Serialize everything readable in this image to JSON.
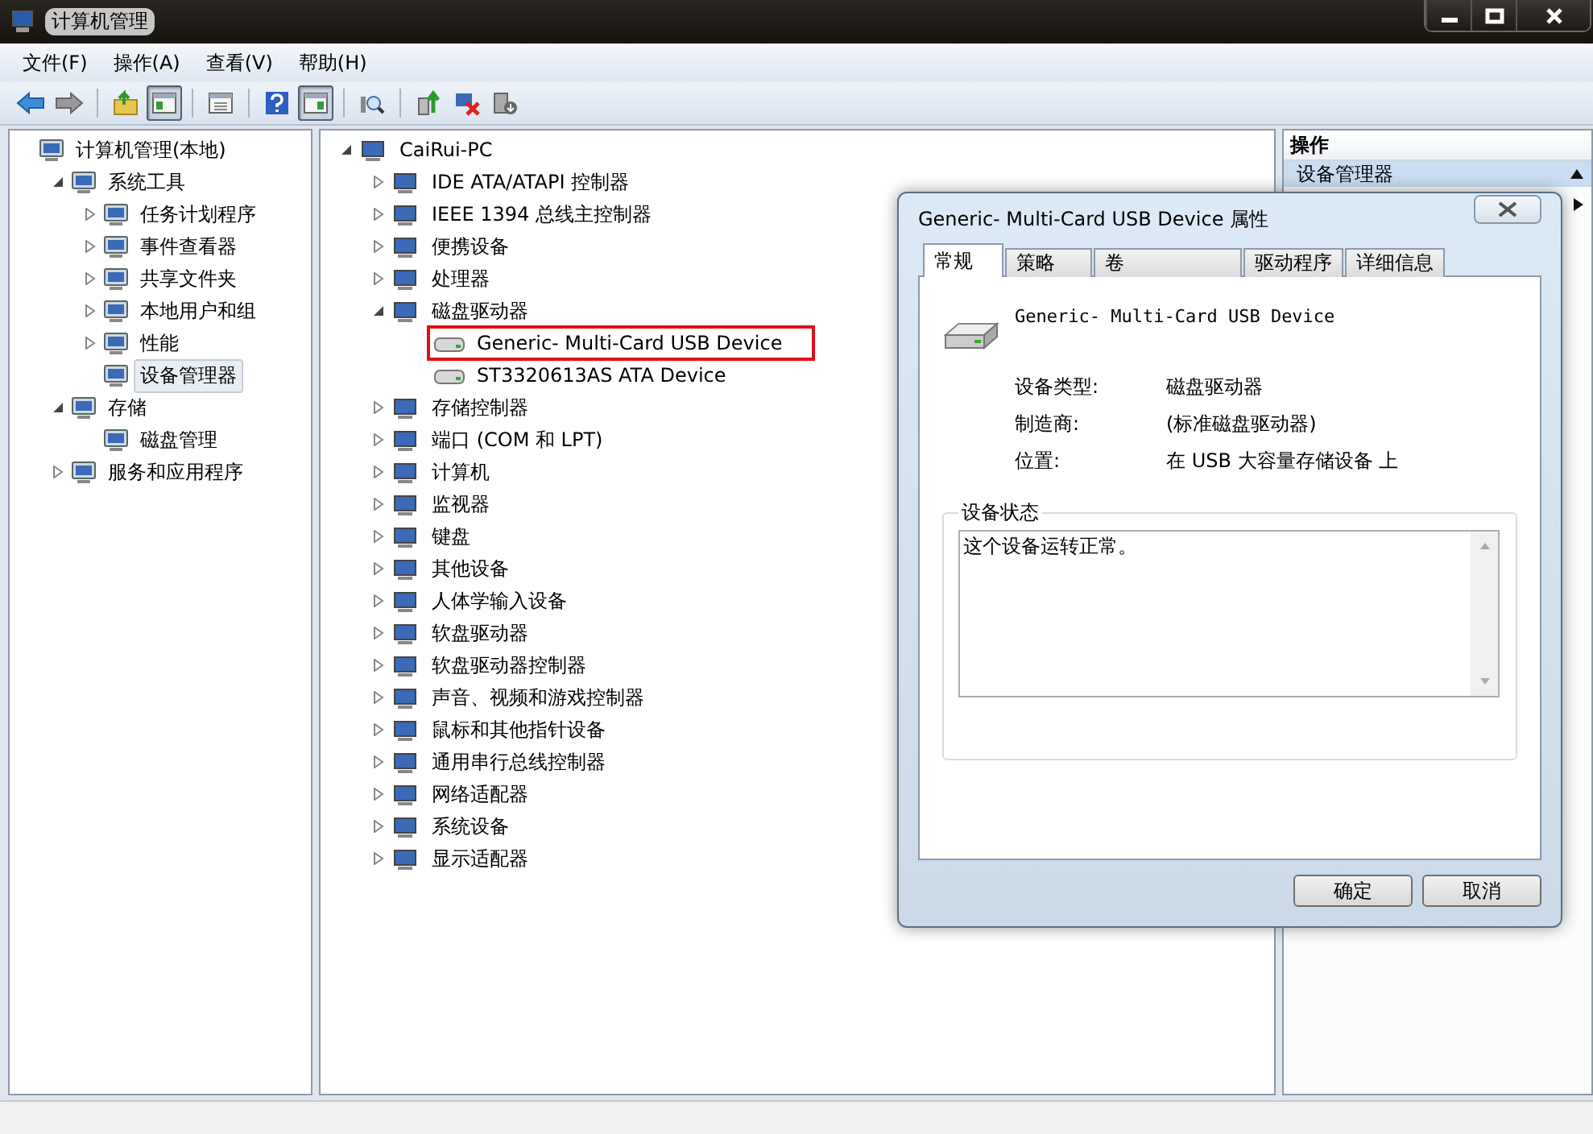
{
  "window": {
    "title": "计算机管理"
  },
  "menu": [
    "文件(F)",
    "操作(A)",
    "查看(V)",
    "帮助(H)"
  ],
  "toolbar": [
    {
      "kind": "back",
      "pressed": false
    },
    {
      "kind": "forward",
      "pressed": false
    },
    {
      "kind": "separator"
    },
    {
      "kind": "up",
      "pressed": false
    },
    {
      "kind": "tree-pane",
      "pressed": true
    },
    {
      "kind": "separator"
    },
    {
      "kind": "list",
      "pressed": false
    },
    {
      "kind": "separator"
    },
    {
      "kind": "help",
      "pressed": false
    },
    {
      "kind": "action-pane",
      "pressed": true
    },
    {
      "kind": "separator"
    },
    {
      "kind": "scan",
      "pressed": false
    },
    {
      "kind": "separator"
    },
    {
      "kind": "update",
      "pressed": false
    },
    {
      "kind": "disable",
      "pressed": false
    },
    {
      "kind": "uninstall",
      "pressed": false
    }
  ],
  "console_tree": [
    {
      "label": "计算机管理(本地)",
      "selected": false,
      "children": [
        {
          "label": "系统工具",
          "expanded": true,
          "selected": false,
          "children": [
            {
              "label": "任务计划程序",
              "expanded": false,
              "selected": false
            },
            {
              "label": "事件查看器",
              "expanded": false,
              "selected": false
            },
            {
              "label": "共享文件夹",
              "expanded": false,
              "selected": false
            },
            {
              "label": "本地用户和组",
              "expanded": false,
              "selected": false
            },
            {
              "label": "性能",
              "expanded": false,
              "selected": false
            },
            {
              "label": "设备管理器",
              "selected": true
            }
          ]
        },
        {
          "label": "存储",
          "expanded": true,
          "selected": false,
          "children": [
            {
              "label": "磁盘管理",
              "selected": false
            }
          ]
        },
        {
          "label": "服务和应用程序",
          "expanded": false,
          "selected": false
        }
      ]
    }
  ],
  "device_tree": [
    {
      "label": "CaiRui-PC",
      "expanded": true,
      "children": [
        {
          "label": "IDE ATA/ATAPI 控制器",
          "expanded": false
        },
        {
          "label": "IEEE 1394 总线主控制器",
          "expanded": false
        },
        {
          "label": "便携设备",
          "expanded": false
        },
        {
          "label": "处理器",
          "expanded": false
        },
        {
          "label": "磁盘驱动器",
          "expanded": true,
          "children": [
            {
              "label": "Generic- Multi-Card USB Device",
              "highlighted": true
            },
            {
              "label": "ST3320613AS ATA Device",
              "highlighted": false
            }
          ]
        },
        {
          "label": "存储控制器",
          "expanded": false
        },
        {
          "label": "端口 (COM 和 LPT)",
          "expanded": false
        },
        {
          "label": "计算机",
          "expanded": false
        },
        {
          "label": "监视器",
          "expanded": false
        },
        {
          "label": "键盘",
          "expanded": false
        },
        {
          "label": "其他设备",
          "expanded": false
        },
        {
          "label": "人体学输入设备",
          "expanded": false
        },
        {
          "label": "软盘驱动器",
          "expanded": false
        },
        {
          "label": "软盘驱动器控制器",
          "expanded": false
        },
        {
          "label": "声音、视频和游戏控制器",
          "expanded": false
        },
        {
          "label": "鼠标和其他指针设备",
          "expanded": false
        },
        {
          "label": "通用串行总线控制器",
          "expanded": false
        },
        {
          "label": "网络适配器",
          "expanded": false
        },
        {
          "label": "系统设备",
          "expanded": false
        },
        {
          "label": "显示适配器",
          "expanded": false
        }
      ]
    }
  ],
  "actions": {
    "title": "操作",
    "items": [
      "设备管理器"
    ]
  },
  "dialog": {
    "title": "Generic- Multi-Card USB Device 属性",
    "tabs": [
      {
        "label": "常规",
        "selected": true
      },
      {
        "label": "策略",
        "selected": false
      },
      {
        "label": "卷",
        "selected": false
      },
      {
        "label": "驱动程序",
        "selected": false
      },
      {
        "label": "详细信息",
        "selected": false
      }
    ],
    "device_name": "Generic- Multi-Card USB Device",
    "properties": [
      {
        "label": "设备类型:",
        "value": "磁盘驱动器"
      },
      {
        "label": "制造商:",
        "value": "(标准磁盘驱动器)"
      },
      {
        "label": "位置:",
        "value": "在 USB 大容量存储设备 上"
      }
    ],
    "status_group": "设备状态",
    "status_text": "这个设备运转正常。",
    "buttons": [
      "确定",
      "取消"
    ]
  }
}
